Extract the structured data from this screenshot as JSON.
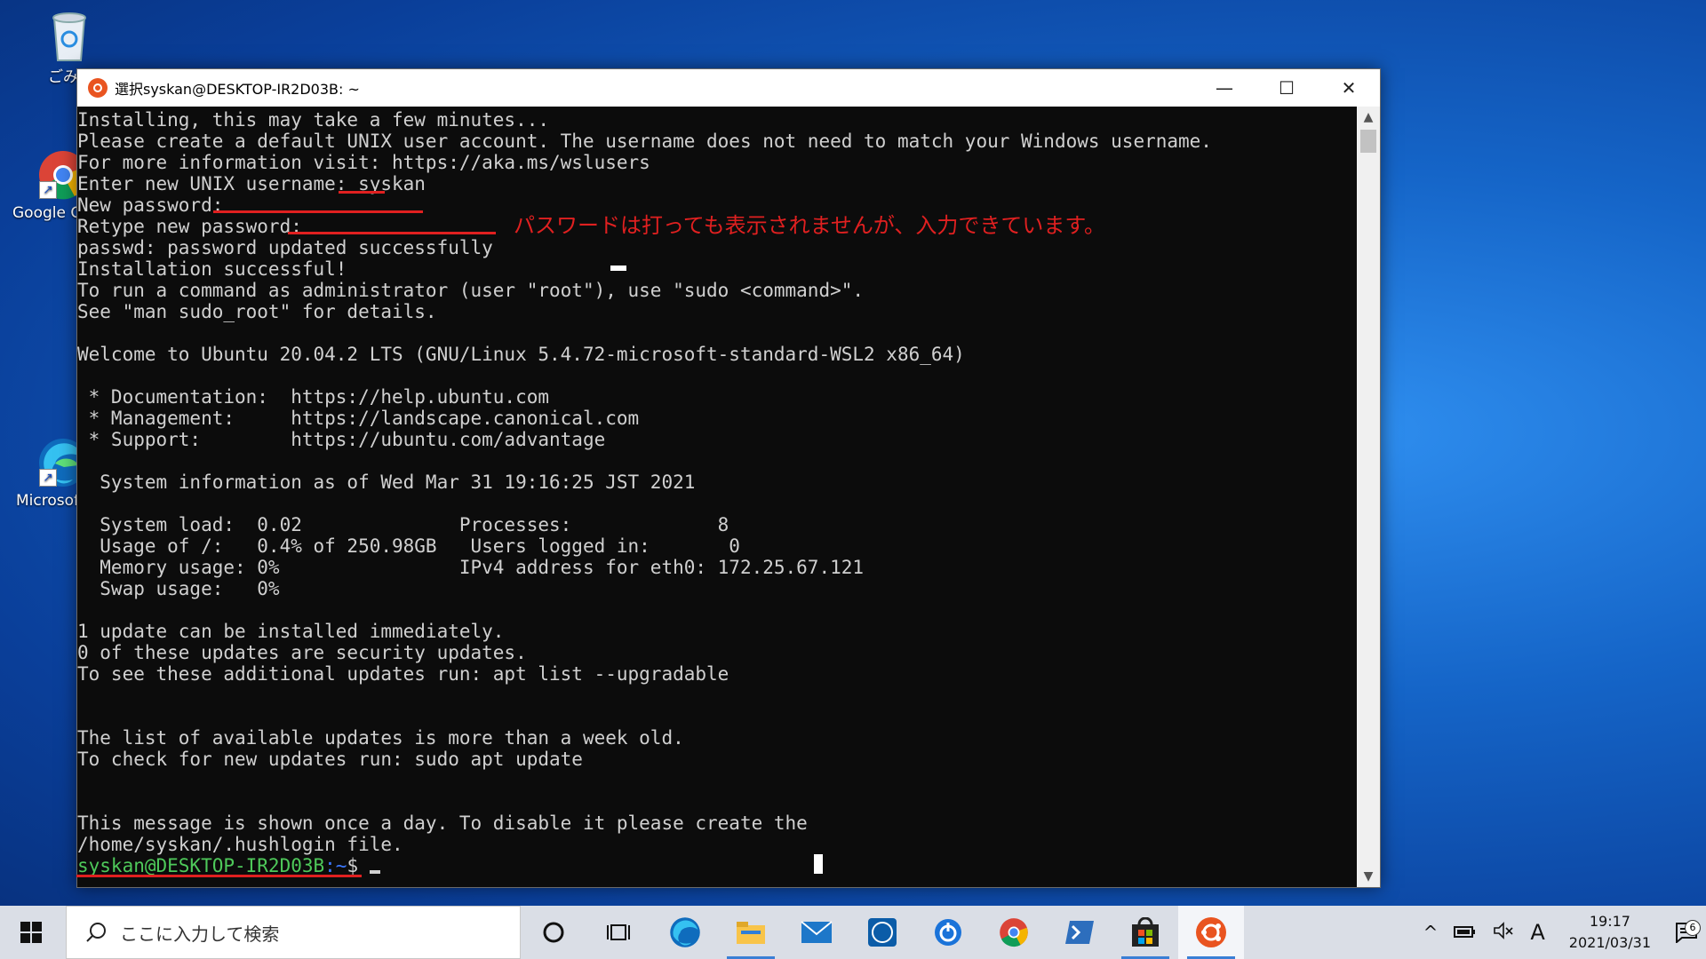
{
  "desktop": {
    "icons": [
      {
        "label": "ごみ箱"
      },
      {
        "label": "Google Chrome"
      },
      {
        "label": "Microsoft Edge"
      }
    ]
  },
  "window": {
    "title": "選択syskan@DESKTOP-IR2D03B: ~",
    "minimize_label": "—",
    "maximize_label": "☐",
    "close_label": "✕"
  },
  "terminal": {
    "lines": [
      "Installing, this may take a few minutes...",
      "Please create a default UNIX user account. The username does not need to match your Windows username.",
      "For more information visit: https://aka.ms/wslusers",
      "Enter new UNIX username: syskan",
      "New password:",
      "Retype new password:",
      "passwd: password updated successfully",
      "Installation successful!",
      "To run a command as administrator (user \"root\"), use \"sudo <command>\".",
      "See \"man sudo_root\" for details.",
      "",
      "Welcome to Ubuntu 20.04.2 LTS (GNU/Linux 5.4.72-microsoft-standard-WSL2 x86_64)",
      "",
      " * Documentation:  https://help.ubuntu.com",
      " * Management:     https://landscape.canonical.com",
      " * Support:        https://ubuntu.com/advantage",
      "",
      "  System information as of Wed Mar 31 19:16:25 JST 2021",
      "",
      "  System load:  0.02              Processes:             8",
      "  Usage of /:   0.4% of 250.98GB   Users logged in:       0",
      "  Memory usage: 0%                IPv4 address for eth0: 172.25.67.121",
      "  Swap usage:   0%",
      "",
      "1 update can be installed immediately.",
      "0 of these updates are security updates.",
      "To see these additional updates run: apt list --upgradable",
      "",
      "",
      "The list of available updates is more than a week old.",
      "To check for new updates run: sudo apt update",
      "",
      "",
      "This message is shown once a day. To disable it please create the",
      "/home/syskan/.hushlogin file."
    ],
    "prompt_user": "syskan@DESKTOP-IR2D03B",
    "prompt_path": ":~",
    "prompt_dollar": "$ "
  },
  "annotation": {
    "text": "パスワードは打っても表示されませんが、入力できています。",
    "color": "#e02020"
  },
  "taskbar": {
    "search_placeholder": "ここに入力して検索",
    "apps": [
      "cortana-icon",
      "task-view-icon",
      "edge-icon",
      "file-explorer-icon",
      "mail-icon",
      "dell-icon",
      "power-icon",
      "chrome-icon",
      "powershell-icon",
      "store-icon",
      "ubuntu-icon"
    ],
    "ime": "A",
    "time": "19:17",
    "date": "2021/03/31",
    "notification_count": "6"
  }
}
